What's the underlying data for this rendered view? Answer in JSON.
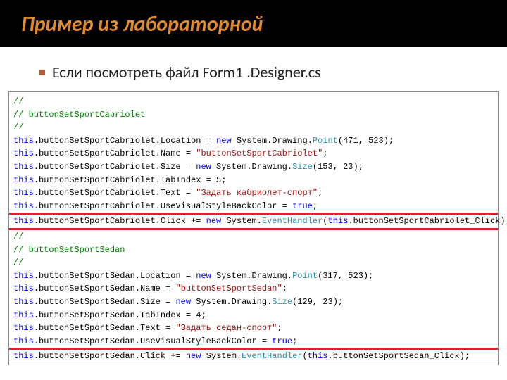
{
  "slide": {
    "title": "Пример из лабораторной",
    "subtitle": "Если посмотреть файл Form1 .Designer.cs"
  },
  "code": {
    "block1": {
      "c1": "// ",
      "c2": "// buttonSetSportCabriolet",
      "c3": "// ",
      "l1_a": "this",
      "l1_b": ".buttonSetSportCabriolet.Location = ",
      "l1_c": "new",
      "l1_d": " System.Drawing.",
      "l1_e": "Point",
      "l1_f": "(471, 523);",
      "l2_a": "this",
      "l2_b": ".buttonSetSportCabriolet.Name = ",
      "l2_c": "\"buttonSetSportCabriolet\"",
      "l2_d": ";",
      "l3_a": "this",
      "l3_b": ".buttonSetSportCabriolet.Size = ",
      "l3_c": "new",
      "l3_d": " System.Drawing.",
      "l3_e": "Size",
      "l3_f": "(153, 23);",
      "l4_a": "this",
      "l4_b": ".buttonSetSportCabriolet.TabIndex = 5;",
      "l5_a": "this",
      "l5_b": ".buttonSetSportCabriolet.Text = ",
      "l5_c": "\"Задать кабриолет-спорт\"",
      "l5_d": ";",
      "l6_a": "this",
      "l6_b": ".buttonSetSportCabriolet.UseVisualStyleBackColor = ",
      "l6_c": "true",
      "l6_d": ";",
      "l7_a": "this",
      "l7_b": ".buttonSetSportCabriolet.Click += ",
      "l7_c": "new",
      "l7_d": " System.",
      "l7_e": "EventHandler",
      "l7_f": "(",
      "l7_g": "this",
      "l7_h": ".buttonSetSportCabriolet_Click);"
    },
    "block2": {
      "c1": "// ",
      "c2": "// buttonSetSportSedan",
      "c3": "// ",
      "l1_a": "this",
      "l1_b": ".buttonSetSportSedan.Location = ",
      "l1_c": "new",
      "l1_d": " System.Drawing.",
      "l1_e": "Point",
      "l1_f": "(317, 523);",
      "l2_a": "this",
      "l2_b": ".buttonSetSportSedan.Name = ",
      "l2_c": "\"buttonSetSportSedan\"",
      "l2_d": ";",
      "l3_a": "this",
      "l3_b": ".buttonSetSportSedan.Size = ",
      "l3_c": "new",
      "l3_d": " System.Drawing.",
      "l3_e": "Size",
      "l3_f": "(129, 23);",
      "l4_a": "this",
      "l4_b": ".buttonSetSportSedan.TabIndex = 4;",
      "l5_a": "this",
      "l5_b": ".buttonSetSportSedan.Text = ",
      "l5_c": "\"Задать седан-спорт\"",
      "l5_d": ";",
      "l6_a": "this",
      "l6_b": ".buttonSetSportSedan.UseVisualStyleBackColor = ",
      "l6_c": "true",
      "l6_d": ";",
      "l7_a": "this",
      "l7_b": ".buttonSetSportSedan.Click += ",
      "l7_c": "new",
      "l7_d": " System.",
      "l7_e": "EventHandler",
      "l7_f": "(",
      "l7_g": "this",
      "l7_h": ".buttonSetSportSedan_Click);"
    }
  }
}
